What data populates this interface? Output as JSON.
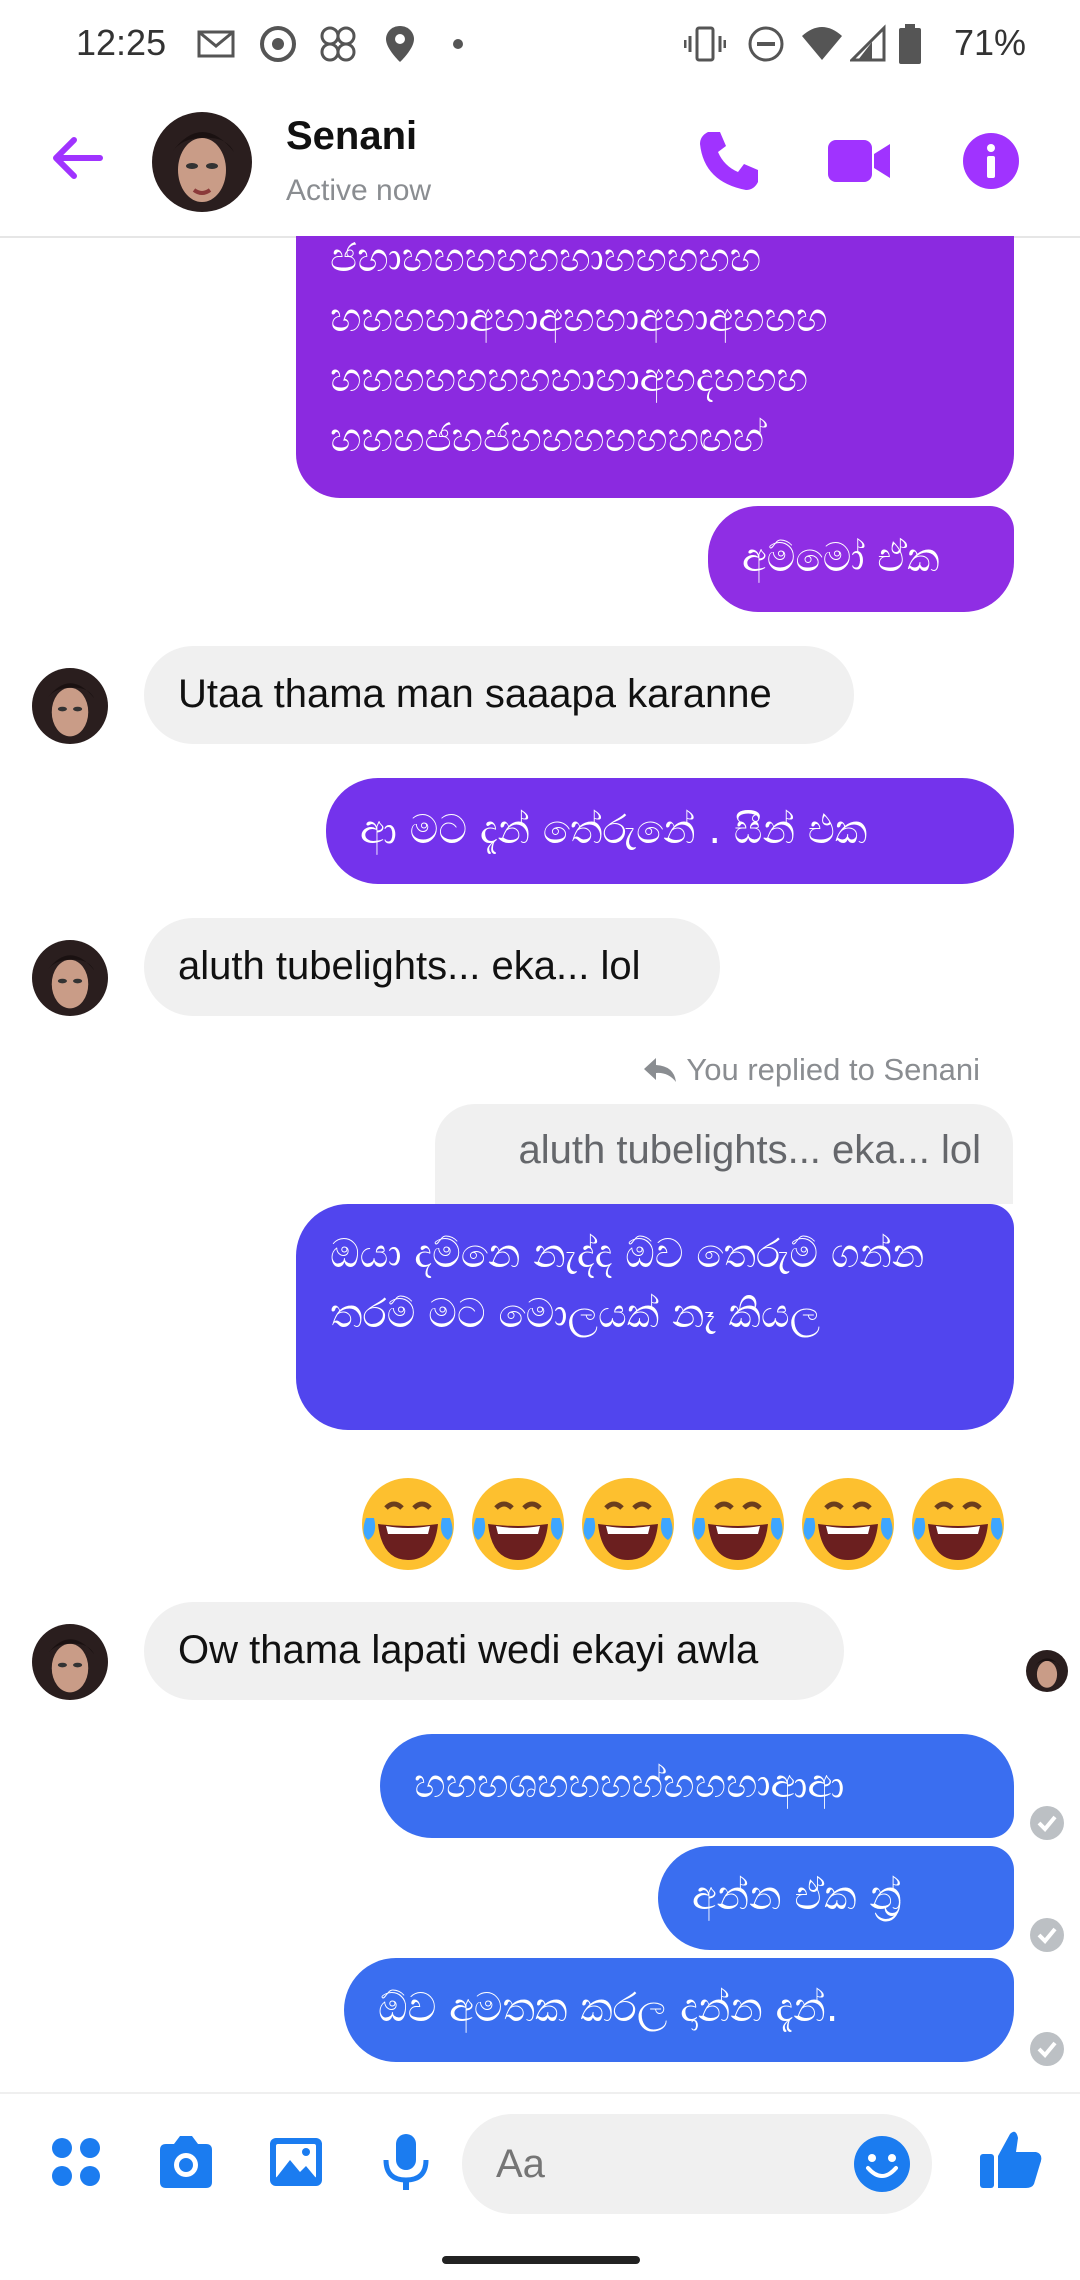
{
  "status_bar": {
    "time": "12:25",
    "battery": "71%",
    "icons": [
      "gmail-icon",
      "chrome-icon",
      "app-icon",
      "location-icon",
      "dot-icon",
      "vibrate-icon",
      "dnd-icon",
      "wifi-icon",
      "signal-icon",
      "battery-icon"
    ]
  },
  "header": {
    "name": "Senani",
    "status": "Active now",
    "accent_color": "#a033ff"
  },
  "messages": [
    {
      "id": "m1",
      "dir": "out",
      "text": "ජහාහහහහහහාහහහහහ හහහහාඅහාඅහහාඅහාඅහහහ හහහහහහහහාහාඅහදහහහ හහහජහජහහහහහහඟහ්"
    },
    {
      "id": "m2",
      "dir": "out",
      "text": "අම්මෝ ඒක"
    },
    {
      "id": "m3",
      "dir": "in",
      "text": "Utaa thama man saaapa karanne"
    },
    {
      "id": "m4",
      "dir": "out",
      "text": "ආ මට දැන් තේරුනේ . සීන් එක"
    },
    {
      "id": "m5",
      "dir": "in",
      "text": "aluth tubelights... eka... lol"
    },
    {
      "id": "m6",
      "dir": "out",
      "text": "ඔයා දම්නෙ නැද්ද ඕව තෙරුම් ගන්න තරම් මට මොලයක් නෑ කියල"
    },
    {
      "id": "m7",
      "dir": "in",
      "text": "Ow thama lapati wedi ekayi awla"
    },
    {
      "id": "m8",
      "dir": "out",
      "text": "හහහශහහහහ්හහහාආආ"
    },
    {
      "id": "m9",
      "dir": "out",
      "text": "අන්න ඒක න්‍ර්‍ර්"
    },
    {
      "id": "m10",
      "dir": "out",
      "text": "ඕව අමතක කරල දාන්න දැන්."
    }
  ],
  "reply": {
    "label": "You replied to Senani",
    "quoted_text": "aluth tubelights... eka... lol"
  },
  "emoji_reaction": {
    "name": "face-with-tears-of-joy",
    "count": 6
  },
  "composer": {
    "placeholder": "Aa"
  },
  "colors": {
    "purple_dark": "#8a2be2",
    "purple": "#9b30ff",
    "indigo": "#5145ee",
    "blue": "#3a6ef0",
    "incoming_bg": "#f0f0f0"
  }
}
